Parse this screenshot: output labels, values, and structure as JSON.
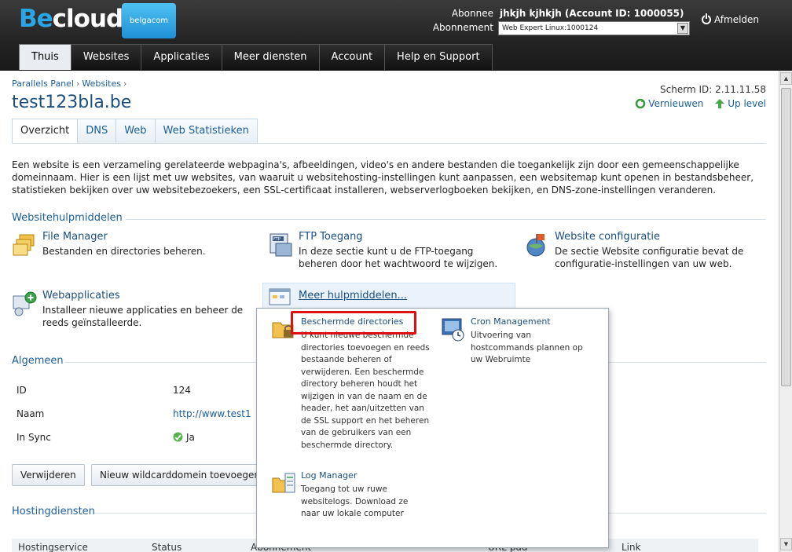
{
  "header": {
    "logo_be": "Be",
    "logo_cloud": "cloud",
    "partner_logo": "belgacom",
    "subscriber_label": "Abonnee",
    "subscriber_value": "jhkjh kjhkjh (Account ID: 1000055)",
    "subscription_label": "Abonnement",
    "subscription_value": "Web Expert Linux:1000124",
    "logout_label": "Afmelden"
  },
  "main_nav": [
    {
      "label": "Thuis"
    },
    {
      "label": "Websites"
    },
    {
      "label": "Applicaties"
    },
    {
      "label": "Meer diensten"
    },
    {
      "label": "Account"
    },
    {
      "label": "Help en Support"
    }
  ],
  "breadcrumb": [
    "Parallels Panel",
    "Websites"
  ],
  "page": {
    "title": "test123bla.be",
    "screen_id": "Scherm ID:  2.11.11.58",
    "refresh_label": "Vernieuwen",
    "up_level_label": "Up level"
  },
  "sub_tabs": [
    {
      "label": "Overzicht"
    },
    {
      "label": "DNS"
    },
    {
      "label": "Web"
    },
    {
      "label": "Web Statistieken"
    }
  ],
  "intro": "Een website is een verzameling gerelateerde webpagina's, afbeeldingen, video's en andere bestanden die toegankelijk zijn door een gemeenschappelijke domeinnaam. Hier is een lijst met uw websites, van waaruit u websitehosting-instellingen kunt aanpassen, een websitemap kunt openen in bestandsbeheer, statistieken bekijken over uw websitebezoekers, een SSL-certificaat installeren, webserverlogboeken bekijken, en DNS-zone-instellingen veranderen.",
  "tools_section": {
    "heading": "Websitehulpmiddelen",
    "tools": [
      {
        "name": "File Manager",
        "desc": "Bestanden en directories beheren."
      },
      {
        "name": "FTP Toegang",
        "desc": "In deze sectie kunt u de FTP-toegang beheren door het wachtwoord te wijzigen."
      },
      {
        "name": "Website configuratie",
        "desc": "De sectie Website configuratie bevat de configuratie-instellingen van uw web."
      },
      {
        "name": "Webapplicaties",
        "desc": "Installeer nieuwe applicaties en beheer de reeds geïnstalleerde."
      }
    ],
    "more_label": "Meer hulpmiddelen..."
  },
  "general": {
    "heading": "Algemeen",
    "rows": [
      {
        "label": "ID",
        "value": "124"
      },
      {
        "label": "Naam",
        "value": "http://www.test1"
      },
      {
        "label": "In Sync",
        "value": "Ja"
      }
    ],
    "delete_button": "Verwijderen",
    "wildcard_button": "Nieuw wildcarddomein toevoegen"
  },
  "hosting": {
    "heading": "Hostingdiensten",
    "columns": [
      "Hostingservice",
      "Status",
      "Abonnement",
      "URL-pad",
      "Link"
    ]
  },
  "popup": {
    "items": [
      {
        "name": "Beschermde directories",
        "desc": "U kunt nieuwe beschermde directories toevoegen en reeds bestaande beheren of verwijderen. Een beschermde directory beheren houdt het wijzigen in van de naam en de header, het aan/uitzetten van de SSL support en het beheren van de gebruikers van een beschermde directory."
      },
      {
        "name": "Cron Management",
        "desc": "Uitvoering van hostcommands plannen op uw Webruimte"
      },
      {
        "name": "Log Manager",
        "desc": "Toegang tot uw ruwe websitelogs. Download ze naar uw lokale computer"
      }
    ]
  },
  "colors": {
    "brand_blue": "#29a6e6",
    "link_blue": "#1a5e9a",
    "header_dark": "#232323",
    "highlight_red": "#dd1111"
  }
}
